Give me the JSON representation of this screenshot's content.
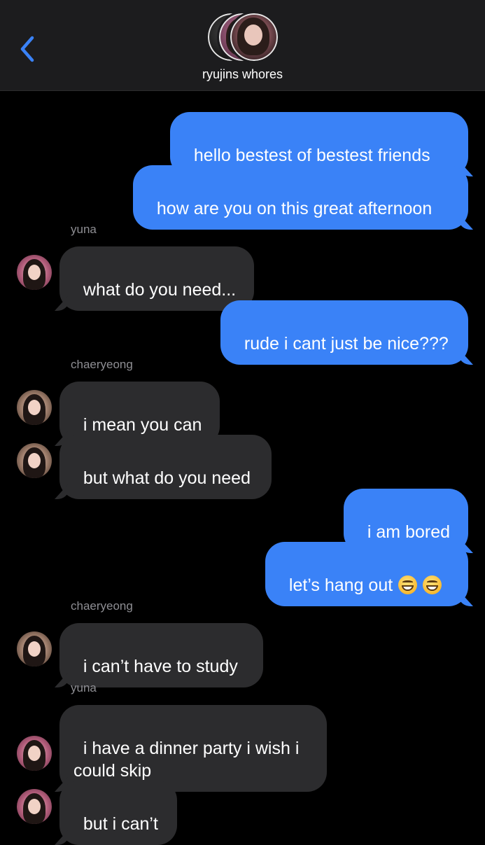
{
  "header": {
    "group_name": "ryujins whores",
    "back_icon": "chevron-left-icon",
    "accent_color": "#3a82f7"
  },
  "messages": [
    {
      "direction": "out",
      "text": "hello bestest of bestest friends"
    },
    {
      "direction": "out",
      "text": "how are you on this great afternoon"
    },
    {
      "sender": "yuna"
    },
    {
      "direction": "in",
      "from": "yuna",
      "text": "what do you need..."
    },
    {
      "direction": "out",
      "text": "rude i cant just be nice???"
    },
    {
      "sender": "chaeryeong"
    },
    {
      "direction": "in",
      "from": "chaeryeong",
      "text": "i mean you can"
    },
    {
      "direction": "in",
      "from": "chaeryeong",
      "text": "but what do you need"
    },
    {
      "direction": "out",
      "text": "i am bored"
    },
    {
      "direction": "out",
      "text": "let’s hang out",
      "emoji": [
        "grinning-face-icon",
        "grinning-face-icon"
      ]
    },
    {
      "sender": "chaeryeong"
    },
    {
      "direction": "in",
      "from": "chaeryeong",
      "text": "i can’t have to study"
    },
    {
      "sender": "yuna"
    },
    {
      "direction": "in",
      "from": "yuna",
      "text": "i have a dinner party i wish i\ncould skip"
    },
    {
      "direction": "in",
      "from": "yuna",
      "text": "but i can’t"
    }
  ],
  "colors": {
    "outgoing_bubble": "#3a82f7",
    "incoming_bubble": "#2c2c2e",
    "sender_label": "#8e8e93",
    "background": "#000000",
    "header_background": "#1c1c1e"
  }
}
